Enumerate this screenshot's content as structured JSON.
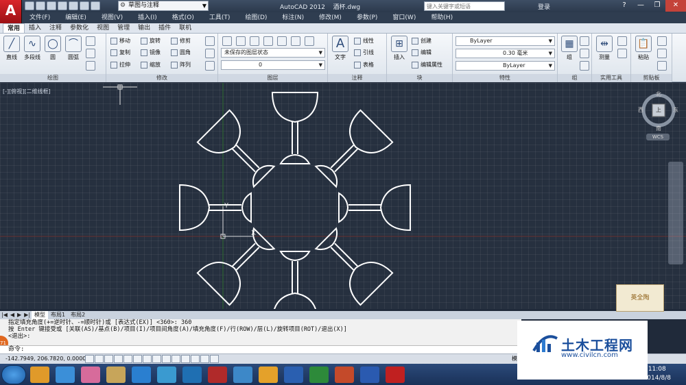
{
  "titlebar": {
    "logo": "A",
    "workspace": "草图与注释",
    "app_title": "AutoCAD 2012",
    "file_name": "酒杯.dwg",
    "search_placeholder": "键入关键字或短语",
    "login": "登录",
    "help": "?"
  },
  "menu": [
    "文件(F)",
    "编辑(E)",
    "视图(V)",
    "插入(I)",
    "格式(O)",
    "工具(T)",
    "绘图(D)",
    "标注(N)",
    "修改(M)",
    "参数(P)",
    "窗口(W)",
    "帮助(H)"
  ],
  "tabs": [
    "常用",
    "插入",
    "注释",
    "参数化",
    "视图",
    "管理",
    "输出",
    "插件",
    "联机"
  ],
  "ribbon": {
    "draw": {
      "title": "绘图",
      "line": "直线",
      "polyline": "多段线",
      "circle": "圆",
      "arc": "圆弧"
    },
    "modify": {
      "title": "修改",
      "move": "移动",
      "rotate": "旋转",
      "trim": "修剪",
      "copy": "复制",
      "mirror": "镜像",
      "fillet": "圆角",
      "stretch": "拉伸",
      "scale": "缩放",
      "array": "阵列"
    },
    "layers": {
      "title": "图层",
      "layer_state": "未保存的图层状态",
      "current_layer": "0"
    },
    "annotation": {
      "title": "注释",
      "text": "文字",
      "linear": "线性",
      "leader": "引线",
      "table": "表格"
    },
    "block": {
      "title": "块",
      "insert": "插入",
      "create": "创建",
      "edit": "编辑",
      "edit_attr": "编辑属性"
    },
    "properties": {
      "title": "特性",
      "color": "ByLayer",
      "lineweight": "0.30 毫米",
      "linetype": "ByLayer"
    },
    "groups": {
      "title": "组",
      "group": "组"
    },
    "utilities": {
      "title": "实用工具",
      "measure": "测量"
    },
    "clipboard": {
      "title": "剪贴板",
      "paste": "粘贴"
    }
  },
  "viewport": {
    "label": "[-][俯视][二维线框]"
  },
  "viewcube": {
    "north": "北",
    "south": "南",
    "east": "东",
    "west": "西",
    "top": "上",
    "wcs": "WCS"
  },
  "layout_tabs": [
    "模型",
    "布局1",
    "布局2"
  ],
  "command": {
    "line1": "指定填充角度(+=逆时针、-=顺时针)或 [表达式(EX)] <360>: 360",
    "line2": "按 Enter 键接受或 [关联(AS)/基点(B)/项目(I)/项目间角度(A)/填充角度(F)/行(ROW)/层(L)/旋转项目(ROT)/退出(X)]",
    "line3": "<退出>:",
    "prompt": "命令:"
  },
  "status": {
    "coords": "-142.7949, 206.7820, 0.0000",
    "model": "模"
  },
  "badge": "71",
  "watermark": {
    "title": "土木工程网",
    "url": "www.civilcn.com",
    "sticker": "英全陶"
  },
  "clock": {
    "time": "11:08",
    "date": "2014/8/8"
  },
  "taskbar_icons": [
    "ie-icon",
    "paint-icon",
    "explorer-icon",
    "media-icon",
    "qq-icon",
    "cloud-icon",
    "photoshop-icon",
    "bird-icon",
    "tools-icon",
    "word-icon",
    "excel-icon",
    "powerpoint-icon",
    "brush-icon",
    "wps-icon",
    "autocad-icon"
  ]
}
